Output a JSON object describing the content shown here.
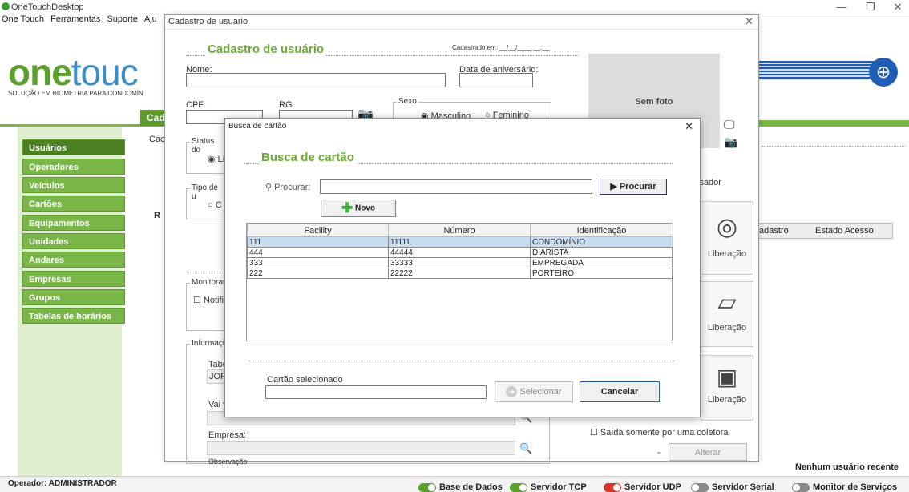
{
  "main_window": {
    "title": "OneTouchDesktop",
    "min": "—",
    "restore": "❐",
    "close": "✕",
    "menu": [
      "One Touch",
      "Ferramentas",
      "Suporte",
      "Aju"
    ]
  },
  "brand": {
    "logo_strong": "one",
    "logo_light": "touc",
    "tagline": "SOLUÇÃO EM BIOMETRIA PARA CONDOMÍN"
  },
  "cad_tab": "Cad",
  "cad_tab_sub": "Cad",
  "sidebar": {
    "items": [
      "Usuários",
      "Operadores",
      "Veículos",
      "Cartões",
      "Equipamentos",
      "Unidades",
      "Andares",
      "Empresas",
      "Grupos",
      "Tabelas de horários"
    ]
  },
  "bg_table": {
    "col1": "adastro",
    "col2": "Estado Acesso"
  },
  "recent_text": "Nenhum usuário recente",
  "status_bar": {
    "operator": "Operador: ADMINISTRADOR",
    "services": [
      {
        "label": "Base de Dados",
        "color": "#5aa02c",
        "on": true
      },
      {
        "label": "Servidor TCP",
        "color": "#5aa02c",
        "on": true
      },
      {
        "label": "Servidor UDP",
        "color": "#d9342b",
        "on": true
      },
      {
        "label": "Servidor Serial",
        "color": "#888888",
        "on": false
      },
      {
        "label": "Monitor de Serviços",
        "color": "#888888",
        "on": false
      }
    ]
  },
  "cadastro": {
    "window_title": "Cadastro de usuario",
    "close": "✕",
    "heading": "Cadastro de usuário",
    "registered": "Cadastrado em: __/__/____ __:__",
    "nome_label": "Nome:",
    "aniversario_label": "Data de aniversário:",
    "cpf_label": "CPF:",
    "rg_label": "RG:",
    "sexo_label": "Sexo",
    "masculino": "Masculino",
    "feminino": "Feminino",
    "status_label": "Status do",
    "status_opt": "Li",
    "tipo_label": "Tipo de u",
    "tipo_opt": "C",
    "r_tab": "R",
    "monitorar_label": "Monitorar",
    "notifi_label": "Notifi",
    "informacoes_label": "Informaçõ",
    "tabela_label": "Tabe",
    "tabela_value": "JOR",
    "vai_label": "Vai v",
    "empresa_label": "Empresa:",
    "observacao_label": "Observação",
    "sem_foto": "Sem foto",
    "usuario_label": "isador",
    "liberacao": "Liberação",
    "saida_label": "Saída somente por uma coletora",
    "dash": "-",
    "alterar": "Alterar"
  },
  "busca": {
    "window_title": "Busca de cartão",
    "close": "✕",
    "heading": "Busca de cartão",
    "procurar_label": "Procurar:",
    "procurar_value": "",
    "procurar_button": "▶ Procurar",
    "novo_button": "Novo",
    "columns": [
      "Facility",
      "Número",
      "Identificação"
    ],
    "rows": [
      [
        "111",
        "11111",
        "CONDOMÍNIO"
      ],
      [
        "444",
        "44444",
        "DIARISTA"
      ],
      [
        "333",
        "33333",
        "EMPREGADA"
      ],
      [
        "222",
        "22222",
        "PORTEIRO"
      ]
    ],
    "selecionado_label": "Cartão selecionado",
    "selecionado_value": "",
    "selecionar_button": "Selecionar",
    "cancelar_button": "Cancelar"
  }
}
